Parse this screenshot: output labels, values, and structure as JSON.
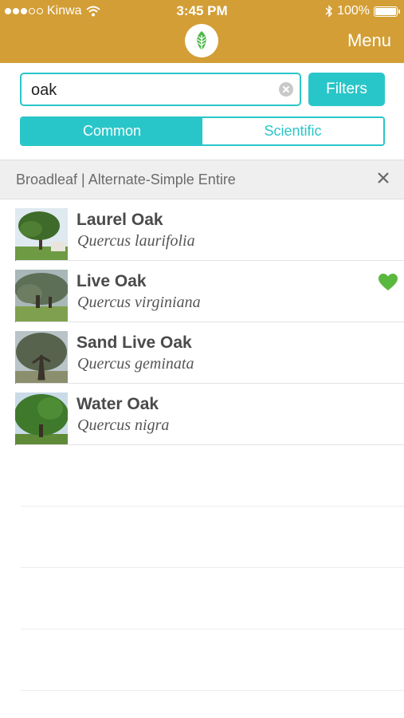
{
  "status_bar": {
    "carrier": "Kinwa",
    "time": "3:45 PM",
    "battery": "100%"
  },
  "header": {
    "menu_label": "Menu",
    "logo_icon": "leaf-icon",
    "bg_color": "#d39e35"
  },
  "search": {
    "value": "oak",
    "filters_label": "Filters"
  },
  "segment": {
    "options": [
      "Common",
      "Scientific"
    ],
    "selected": "Common"
  },
  "active_filter": {
    "text": "Broadleaf | Alternate-Simple Entire"
  },
  "results": [
    {
      "common": "Laurel Oak",
      "scientific": "Quercus laurifolia",
      "favorite": false
    },
    {
      "common": "Live Oak",
      "scientific": "Quercus virginiana",
      "favorite": true
    },
    {
      "common": "Sand Live Oak",
      "scientific": "Quercus geminata",
      "favorite": false
    },
    {
      "common": "Water Oak",
      "scientific": "Quercus nigra",
      "favorite": false
    }
  ],
  "colors": {
    "accent": "#29c6c9",
    "header": "#d39e35",
    "favorite": "#5bb83f"
  }
}
